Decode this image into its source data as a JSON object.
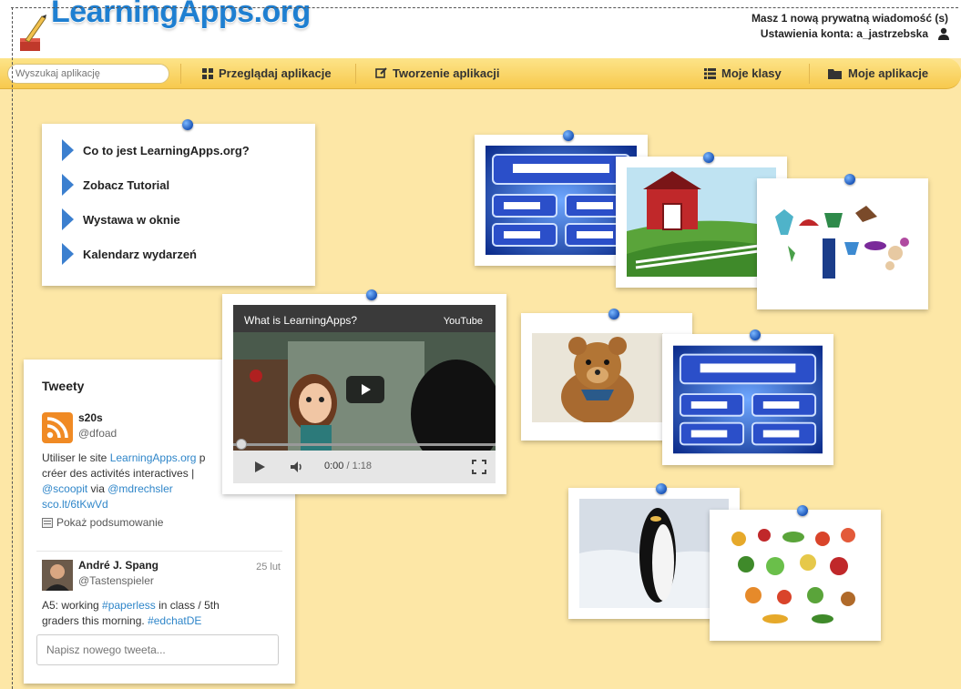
{
  "header": {
    "logo_text": "LearningApps.org",
    "message_notice": "Masz 1 nową prywatną wiadomość (s)",
    "account_settings": "Ustawienia konta: a_jastrzebska"
  },
  "nav": {
    "search_placeholder": "Wyszukaj aplikację",
    "browse": "Przeglądaj aplikacje",
    "create": "Tworzenie aplikacji",
    "classes": "Moje klasy",
    "my_apps": "Moje aplikacje"
  },
  "menu": {
    "items": [
      "Co to jest LearningApps.org?",
      "Zobacz Tutorial",
      "Wystawa w oknie",
      "Kalendarz wydarzeń"
    ]
  },
  "tweets": {
    "title": "Tweety",
    "items": [
      {
        "name": "s20s",
        "handle": "@dfoad",
        "text_pre": "Utiliser le site ",
        "link1": "LearningApps.org",
        "text_mid": " p",
        "line2": "créer des activités interactives |",
        "mention1": "@scoopit",
        "via": " via ",
        "mention2": "@mdrechsler",
        "short_link": "sco.lt/6tKwVd",
        "summary": "Pokaż podsumowanie"
      },
      {
        "name": "André J. Spang",
        "handle": "@Tastenspieler",
        "date": "25 lut",
        "text_pre": "A5: working ",
        "hashtag1": "#paperless",
        "text_mid": " in class / 5th",
        "line2_pre": "graders this morning. ",
        "hashtag2": "#edchatDE"
      }
    ],
    "compose_placeholder": "Napisz nowego tweeta..."
  },
  "video": {
    "title": "What is LearningApps?",
    "source": "YouTube",
    "time": "0:00",
    "duration": "/ 1:18"
  },
  "colors": {
    "background": "#fde7a6",
    "nav": "#f7c94d",
    "logo": "#1e7fd1",
    "link": "#2f86c9",
    "pin": "#1c56b8"
  }
}
